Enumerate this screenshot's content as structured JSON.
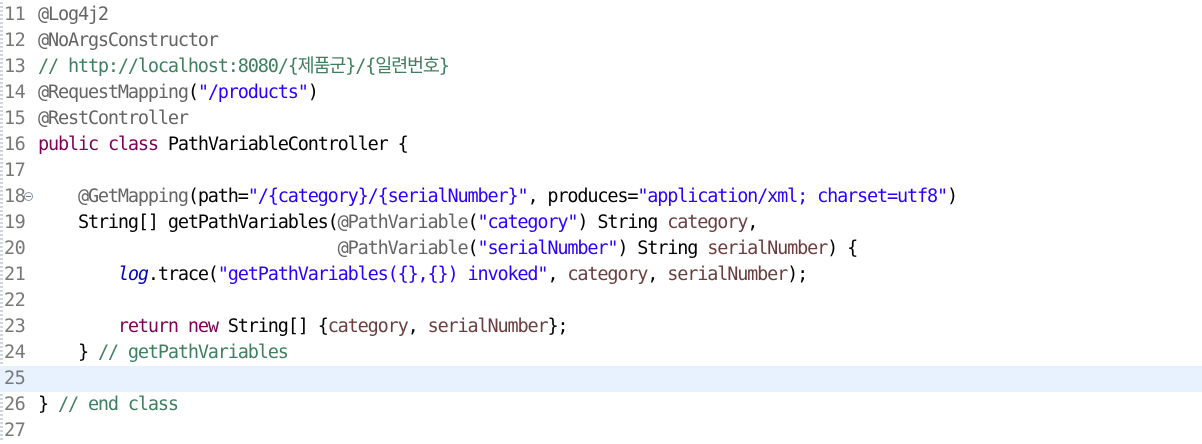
{
  "editor": {
    "language": "java",
    "current_line": 25,
    "lines": [
      {
        "n": "11",
        "tokens": [
          {
            "t": "@Log4j2",
            "c": "ann"
          }
        ]
      },
      {
        "n": "12",
        "tokens": [
          {
            "t": "@NoArgsConstructor",
            "c": "ann"
          }
        ]
      },
      {
        "n": "13",
        "tokens": [
          {
            "t": "// http://localhost:8080/{제품군}/{일련번호}",
            "c": "cmt"
          }
        ]
      },
      {
        "n": "14",
        "tokens": [
          {
            "t": "@RequestMapping",
            "c": "ann"
          },
          {
            "t": "(",
            "c": "pln"
          },
          {
            "t": "\"/products\"",
            "c": "str"
          },
          {
            "t": ")",
            "c": "pln"
          }
        ]
      },
      {
        "n": "15",
        "tokens": [
          {
            "t": "@RestController",
            "c": "ann"
          }
        ]
      },
      {
        "n": "16",
        "tokens": [
          {
            "t": "public",
            "c": "kw"
          },
          {
            "t": " ",
            "c": "pln"
          },
          {
            "t": "class",
            "c": "kw"
          },
          {
            "t": " PathVariableController {",
            "c": "pln"
          }
        ]
      },
      {
        "n": "17",
        "tokens": []
      },
      {
        "n": "18",
        "fold": true,
        "tokens": [
          {
            "t": "    ",
            "c": "pln"
          },
          {
            "t": "@GetMapping",
            "c": "ann"
          },
          {
            "t": "(path=",
            "c": "pln"
          },
          {
            "t": "\"/{category}/{serialNumber}\"",
            "c": "str"
          },
          {
            "t": ", produces=",
            "c": "pln"
          },
          {
            "t": "\"application/xml; charset=utf8\"",
            "c": "str"
          },
          {
            "t": ")",
            "c": "pln"
          }
        ]
      },
      {
        "n": "19",
        "tokens": [
          {
            "t": "    String[] getPathVariables(",
            "c": "pln"
          },
          {
            "t": "@PathVariable",
            "c": "ann"
          },
          {
            "t": "(",
            "c": "pln"
          },
          {
            "t": "\"category\"",
            "c": "str"
          },
          {
            "t": ") String ",
            "c": "pln"
          },
          {
            "t": "category",
            "c": "var"
          },
          {
            "t": ",",
            "c": "pln"
          }
        ]
      },
      {
        "n": "20",
        "tokens": [
          {
            "t": "                              ",
            "c": "pln"
          },
          {
            "t": "@PathVariable",
            "c": "ann"
          },
          {
            "t": "(",
            "c": "pln"
          },
          {
            "t": "\"serialNumber\"",
            "c": "str"
          },
          {
            "t": ") String ",
            "c": "pln"
          },
          {
            "t": "serialNumber",
            "c": "var"
          },
          {
            "t": ") {",
            "c": "pln"
          }
        ]
      },
      {
        "n": "21",
        "tokens": [
          {
            "t": "        ",
            "c": "pln"
          },
          {
            "t": "log",
            "c": "fld"
          },
          {
            "t": ".trace(",
            "c": "pln"
          },
          {
            "t": "\"getPathVariables({},{}) invoked\"",
            "c": "str"
          },
          {
            "t": ", ",
            "c": "pln"
          },
          {
            "t": "category",
            "c": "var"
          },
          {
            "t": ", ",
            "c": "pln"
          },
          {
            "t": "serialNumber",
            "c": "var"
          },
          {
            "t": ");",
            "c": "pln"
          }
        ]
      },
      {
        "n": "22",
        "tokens": []
      },
      {
        "n": "23",
        "tokens": [
          {
            "t": "        ",
            "c": "pln"
          },
          {
            "t": "return",
            "c": "kw"
          },
          {
            "t": " ",
            "c": "pln"
          },
          {
            "t": "new",
            "c": "kw"
          },
          {
            "t": " String[] {",
            "c": "pln"
          },
          {
            "t": "category",
            "c": "var"
          },
          {
            "t": ", ",
            "c": "pln"
          },
          {
            "t": "serialNumber",
            "c": "var"
          },
          {
            "t": "};",
            "c": "pln"
          }
        ]
      },
      {
        "n": "24",
        "tokens": [
          {
            "t": "    } ",
            "c": "pln"
          },
          {
            "t": "// getPathVariables",
            "c": "cmt"
          }
        ]
      },
      {
        "n": "25",
        "tokens": []
      },
      {
        "n": "26",
        "tokens": [
          {
            "t": "} ",
            "c": "pln"
          },
          {
            "t": "// end class",
            "c": "cmt"
          }
        ]
      },
      {
        "n": "27",
        "tokens": []
      }
    ]
  }
}
